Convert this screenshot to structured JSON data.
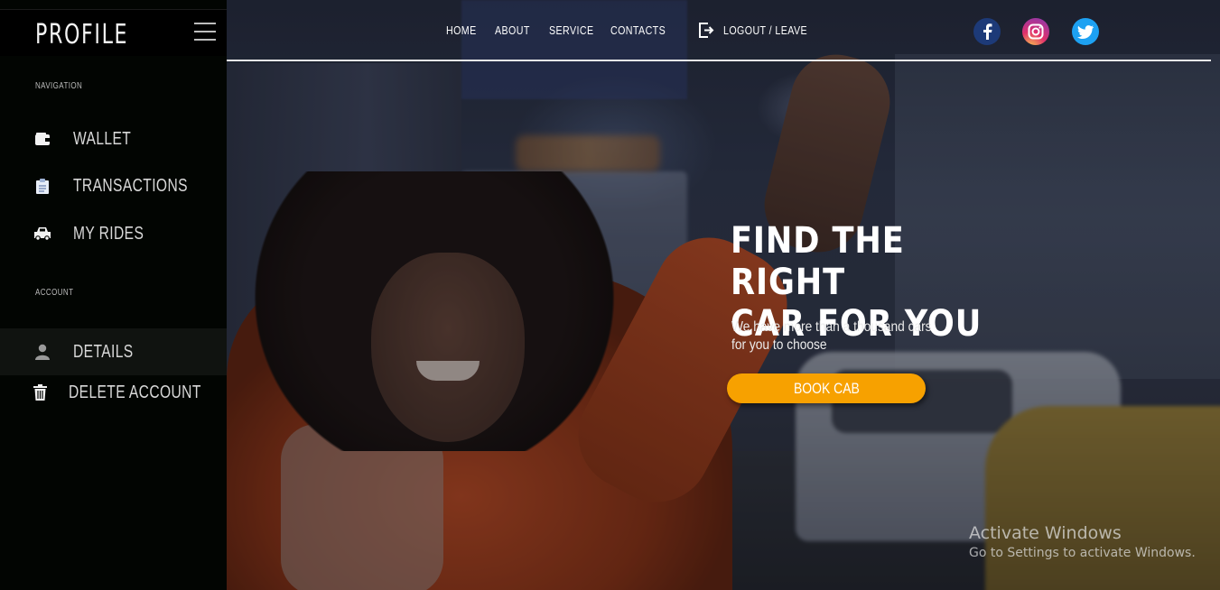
{
  "sidebar": {
    "title": "PROFILE",
    "menu_icon": "hamburger-icon",
    "sections": [
      {
        "heading": "NAVIGATION",
        "items": [
          {
            "label": "WALLET",
            "icon": "wallet-icon"
          },
          {
            "label": "TRANSACTIONS",
            "icon": "clipboard-icon"
          },
          {
            "label": "MY RIDES",
            "icon": "taxi-icon"
          }
        ]
      },
      {
        "heading": "ACCOUNT",
        "items": [
          {
            "label": "DETAILS",
            "icon": "user-icon",
            "active": true
          },
          {
            "label": "DELETE ACCOUNT",
            "icon": "trash-icon"
          }
        ]
      }
    ]
  },
  "topnav": {
    "links": [
      "HOME",
      "ABOUT",
      "SERVICE",
      "CONTACTS"
    ],
    "logout_label": "LOGOUT / LEAVE",
    "logout_icon": "sign-out-icon",
    "social": [
      {
        "name": "facebook-icon",
        "color": "#1d3a78"
      },
      {
        "name": "instagram-icon",
        "color": "#e1306c"
      },
      {
        "name": "twitter-icon",
        "color": "#1da1f2"
      }
    ]
  },
  "hero": {
    "headline_line1": "FIND THE RIGHT",
    "headline_line2": "CAR FOR YOU",
    "subtext_line1": "We have more than a thousand cars",
    "subtext_line2": "for you to choose",
    "cta_label": "BOOK CAB",
    "cta_color": "#f7a100"
  },
  "watermark": {
    "title": "Activate Windows",
    "subtitle": "Go to Settings to activate Windows."
  }
}
